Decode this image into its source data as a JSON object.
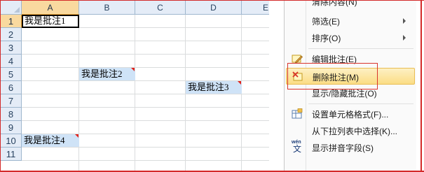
{
  "spreadsheet": {
    "columns": [
      "A",
      "B",
      "C",
      "D",
      "E"
    ],
    "rows": [
      "1",
      "2",
      "3",
      "4",
      "5",
      "6",
      "7",
      "8",
      "9",
      "10",
      "11"
    ],
    "active_column": "A",
    "active_row": "1",
    "cells": {
      "a1": "我是批注1",
      "b5": "我是批注2",
      "d6": "我是批注3",
      "a10": "我是批注4"
    }
  },
  "context_menu": {
    "items": [
      {
        "label": "清除内容(N)",
        "icon": "",
        "submenu": false
      },
      {
        "label": "筛选(E)",
        "icon": "",
        "submenu": true
      },
      {
        "label": "排序(O)",
        "icon": "",
        "submenu": true
      },
      {
        "label": "编辑批注(E)",
        "icon": "edit-comment-icon",
        "submenu": false
      },
      {
        "label": "删除批注(M)",
        "icon": "delete-comment-icon",
        "submenu": false
      },
      {
        "label": "显示/隐藏批注(O)",
        "icon": "",
        "submenu": false
      },
      {
        "label": "设置单元格格式(F)...",
        "icon": "format-cells-icon",
        "submenu": false
      },
      {
        "label": "从下拉列表中选择(K)...",
        "icon": "",
        "submenu": false
      },
      {
        "label": "显示拼音字段(S)",
        "icon": "phonetic-field-icon",
        "submenu": false
      }
    ],
    "phonetic_icon_text": "wén",
    "phonetic_icon_char": "文",
    "highlighted_item": "删除批注(M)"
  },
  "colors": {
    "highlight_red": "#d9342b",
    "comment_marker": "#e2231a",
    "header_active": "#f9d99f",
    "cell_highlight": "#cfe3f7"
  }
}
